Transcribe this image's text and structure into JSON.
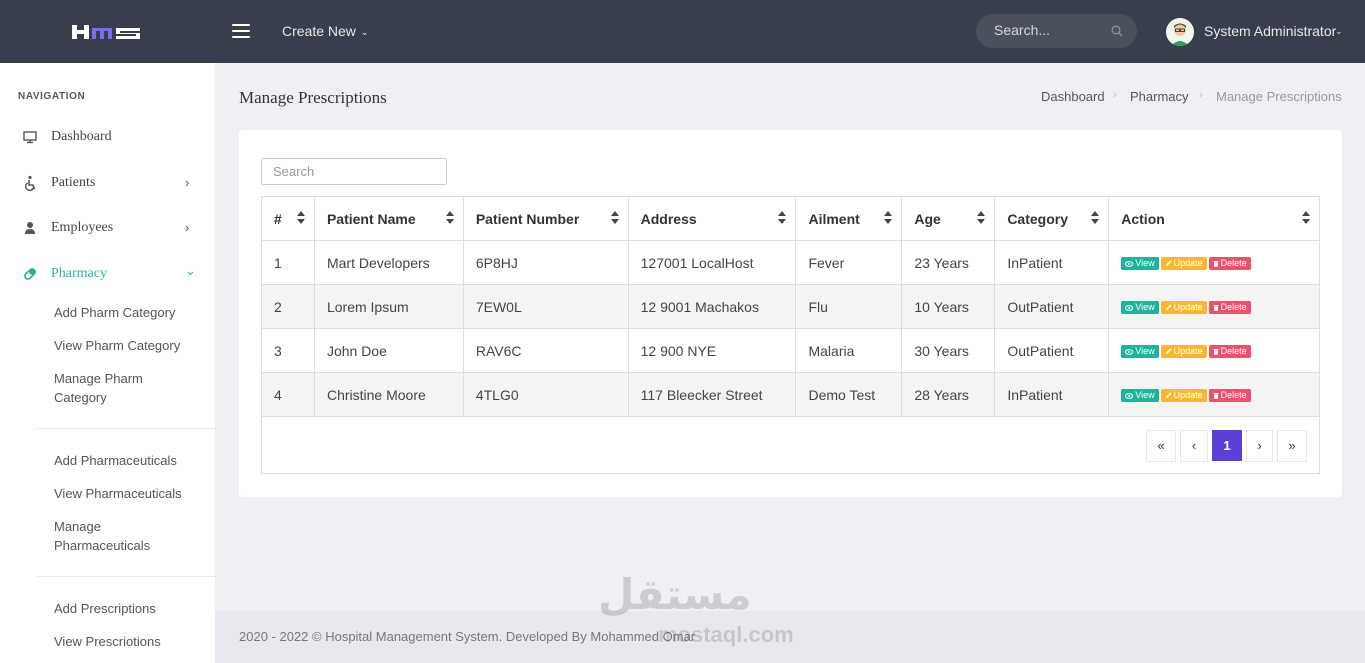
{
  "app": {
    "logo_text": "HMS",
    "create_new_label": "Create New",
    "search_placeholder": "Search...",
    "user_name": "System Administrator"
  },
  "sidebar": {
    "heading": "NAVIGATION",
    "items": [
      {
        "label": "Dashboard",
        "icon": "monitor-icon"
      },
      {
        "label": "Patients",
        "icon": "wheelchair-icon"
      },
      {
        "label": "Employees",
        "icon": "user-icon"
      },
      {
        "label": "Pharmacy",
        "icon": "pill-icon"
      }
    ],
    "pharmacy_sub": [
      {
        "label": "Add Pharm Category"
      },
      {
        "label": "View Pharm Category"
      },
      {
        "label": "Manage Pharm Category"
      },
      {
        "label": "Add Pharmaceuticals"
      },
      {
        "label": "View Pharmaceuticals"
      },
      {
        "label": "Manage Pharmaceuticals"
      },
      {
        "label": "Add Prescriptions"
      },
      {
        "label": "View Prescriotions"
      }
    ]
  },
  "page": {
    "title": "Manage Prescriptions",
    "breadcrumb": [
      "Dashboard",
      "Pharmacy",
      "Manage Prescriptions"
    ],
    "table_search_placeholder": "Search"
  },
  "table": {
    "columns": [
      "#",
      "Patient Name",
      "Patient Number",
      "Address",
      "Ailment",
      "Age",
      "Category",
      "Action"
    ],
    "rows": [
      {
        "num": "1",
        "name": "Mart Developers",
        "number": "6P8HJ",
        "address": "127001 LocalHost",
        "ailment": "Fever",
        "age": "23 Years",
        "category": "InPatient"
      },
      {
        "num": "2",
        "name": "Lorem Ipsum",
        "number": "7EW0L",
        "address": "12 9001 Machakos",
        "ailment": "Flu",
        "age": "10 Years",
        "category": "OutPatient"
      },
      {
        "num": "3",
        "name": "John Doe",
        "number": "RAV6C",
        "address": "12 900 NYE",
        "ailment": "Malaria",
        "age": "30 Years",
        "category": "OutPatient"
      },
      {
        "num": "4",
        "name": "Christine Moore",
        "number": "4TLG0",
        "address": "117 Bleecker Street",
        "ailment": "Demo Test",
        "age": "28 Years",
        "category": "InPatient"
      }
    ],
    "actions": {
      "view": "View",
      "update": "Update",
      "delete": "Delete"
    }
  },
  "pagination": {
    "first": "«",
    "prev": "‹",
    "current": "1",
    "next": "›",
    "last": "»"
  },
  "footer": {
    "text": "2020 - 2022 © Hospital Management System. Developed By Mohammed Omar"
  },
  "watermark": {
    "arabic": "مستقل",
    "latin": "mostaql.com"
  },
  "colors": {
    "topbar": "#383e4b",
    "accent": "#2bb39c",
    "view": "#1fb39a",
    "update": "#f7b733",
    "delete": "#e8526a",
    "page_active": "#5b3fd6"
  }
}
